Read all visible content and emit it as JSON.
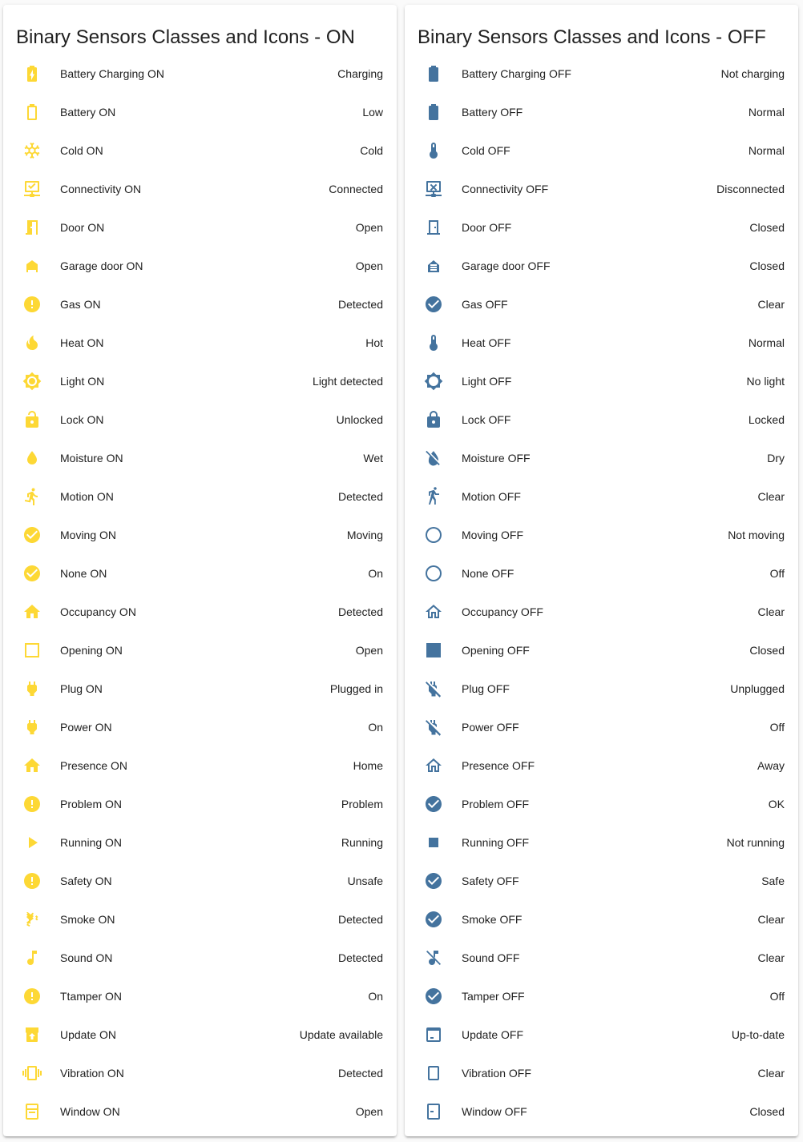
{
  "colors": {
    "on": "#fdd835",
    "off": "#44739e"
  },
  "cards": [
    {
      "title": "Binary Sensors Classes and Icons - ON",
      "state_class": "on",
      "rows": [
        {
          "name": "Battery Charging ON",
          "state": "Charging",
          "icon": "battery-charging-icon"
        },
        {
          "name": "Battery ON",
          "state": "Low",
          "icon": "battery-outline-icon"
        },
        {
          "name": "Cold ON",
          "state": "Cold",
          "icon": "snowflake-icon"
        },
        {
          "name": "Connectivity ON",
          "state": "Connected",
          "icon": "server-network-icon"
        },
        {
          "name": "Door ON",
          "state": "Open",
          "icon": "door-open-icon"
        },
        {
          "name": "Garage door ON",
          "state": "Open",
          "icon": "garage-open-icon"
        },
        {
          "name": "Gas ON",
          "state": "Detected",
          "icon": "alert-circle-icon"
        },
        {
          "name": "Heat ON",
          "state": "Hot",
          "icon": "fire-icon"
        },
        {
          "name": "Light ON",
          "state": "Light detected",
          "icon": "brightness-icon"
        },
        {
          "name": "Lock ON",
          "state": "Unlocked",
          "icon": "lock-open-icon"
        },
        {
          "name": "Moisture ON",
          "state": "Wet",
          "icon": "water-icon"
        },
        {
          "name": "Motion ON",
          "state": "Detected",
          "icon": "run-icon"
        },
        {
          "name": "Moving ON",
          "state": "Moving",
          "icon": "check-circle-icon"
        },
        {
          "name": "None ON",
          "state": "On",
          "icon": "check-circle-icon"
        },
        {
          "name": "Occupancy ON",
          "state": "Detected",
          "icon": "home-icon"
        },
        {
          "name": "Opening ON",
          "state": "Open",
          "icon": "square-outline-icon"
        },
        {
          "name": "Plug ON",
          "state": "Plugged in",
          "icon": "power-plug-icon"
        },
        {
          "name": "Power ON",
          "state": "On",
          "icon": "power-plug-icon"
        },
        {
          "name": "Presence ON",
          "state": "Home",
          "icon": "home-icon"
        },
        {
          "name": "Problem ON",
          "state": "Problem",
          "icon": "alert-circle-icon"
        },
        {
          "name": "Running ON",
          "state": "Running",
          "icon": "play-icon"
        },
        {
          "name": "Safety ON",
          "state": "Unsafe",
          "icon": "alert-circle-icon"
        },
        {
          "name": "Smoke ON",
          "state": "Detected",
          "icon": "smoke-icon"
        },
        {
          "name": "Sound ON",
          "state": "Detected",
          "icon": "music-note-icon"
        },
        {
          "name": "Ttamper ON",
          "state": "On",
          "icon": "alert-circle-icon"
        },
        {
          "name": "Update ON",
          "state": "Update available",
          "icon": "package-up-icon"
        },
        {
          "name": "Vibration ON",
          "state": "Detected",
          "icon": "vibrate-icon"
        },
        {
          "name": "Window ON",
          "state": "Open",
          "icon": "window-open-icon"
        }
      ]
    },
    {
      "title": "Binary Sensors Classes and Icons - OFF",
      "state_class": "off",
      "rows": [
        {
          "name": "Battery Charging OFF",
          "state": "Not charging",
          "icon": "battery-icon"
        },
        {
          "name": "Battery OFF",
          "state": "Normal",
          "icon": "battery-icon"
        },
        {
          "name": "Cold OFF",
          "state": "Normal",
          "icon": "thermometer-icon"
        },
        {
          "name": "Connectivity OFF",
          "state": "Disconnected",
          "icon": "server-network-off-icon"
        },
        {
          "name": "Door OFF",
          "state": "Closed",
          "icon": "door-closed-icon"
        },
        {
          "name": "Garage door OFF",
          "state": "Closed",
          "icon": "garage-icon"
        },
        {
          "name": "Gas OFF",
          "state": "Clear",
          "icon": "check-circle-icon"
        },
        {
          "name": "Heat OFF",
          "state": "Normal",
          "icon": "thermometer-icon"
        },
        {
          "name": "Light OFF",
          "state": "No light",
          "icon": "brightness-outline-icon"
        },
        {
          "name": "Lock OFF",
          "state": "Locked",
          "icon": "lock-icon"
        },
        {
          "name": "Moisture OFF",
          "state": "Dry",
          "icon": "water-off-icon"
        },
        {
          "name": "Motion OFF",
          "state": "Clear",
          "icon": "walk-icon"
        },
        {
          "name": "Moving OFF",
          "state": "Not moving",
          "icon": "checkbox-blank-circle-outline-icon"
        },
        {
          "name": "None OFF",
          "state": "Off",
          "icon": "checkbox-blank-circle-outline-icon"
        },
        {
          "name": "Occupancy OFF",
          "state": "Clear",
          "icon": "home-outline-icon"
        },
        {
          "name": "Opening OFF",
          "state": "Closed",
          "icon": "square-icon"
        },
        {
          "name": "Plug OFF",
          "state": "Unplugged",
          "icon": "power-plug-off-icon"
        },
        {
          "name": "Power OFF",
          "state": "Off",
          "icon": "power-plug-off-icon"
        },
        {
          "name": "Presence OFF",
          "state": "Away",
          "icon": "home-outline-icon"
        },
        {
          "name": "Problem OFF",
          "state": "OK",
          "icon": "check-circle-icon"
        },
        {
          "name": "Running OFF",
          "state": "Not running",
          "icon": "stop-icon"
        },
        {
          "name": "Safety OFF",
          "state": "Safe",
          "icon": "check-circle-icon"
        },
        {
          "name": "Smoke OFF",
          "state": "Clear",
          "icon": "check-circle-icon"
        },
        {
          "name": "Sound OFF",
          "state": "Clear",
          "icon": "music-note-off-icon"
        },
        {
          "name": "Tamper OFF",
          "state": "Off",
          "icon": "check-circle-icon"
        },
        {
          "name": "Update OFF",
          "state": "Up-to-date",
          "icon": "package-icon"
        },
        {
          "name": "Vibration OFF",
          "state": "Clear",
          "icon": "crop-portrait-icon"
        },
        {
          "name": "Window OFF",
          "state": "Closed",
          "icon": "window-closed-icon"
        }
      ]
    }
  ]
}
